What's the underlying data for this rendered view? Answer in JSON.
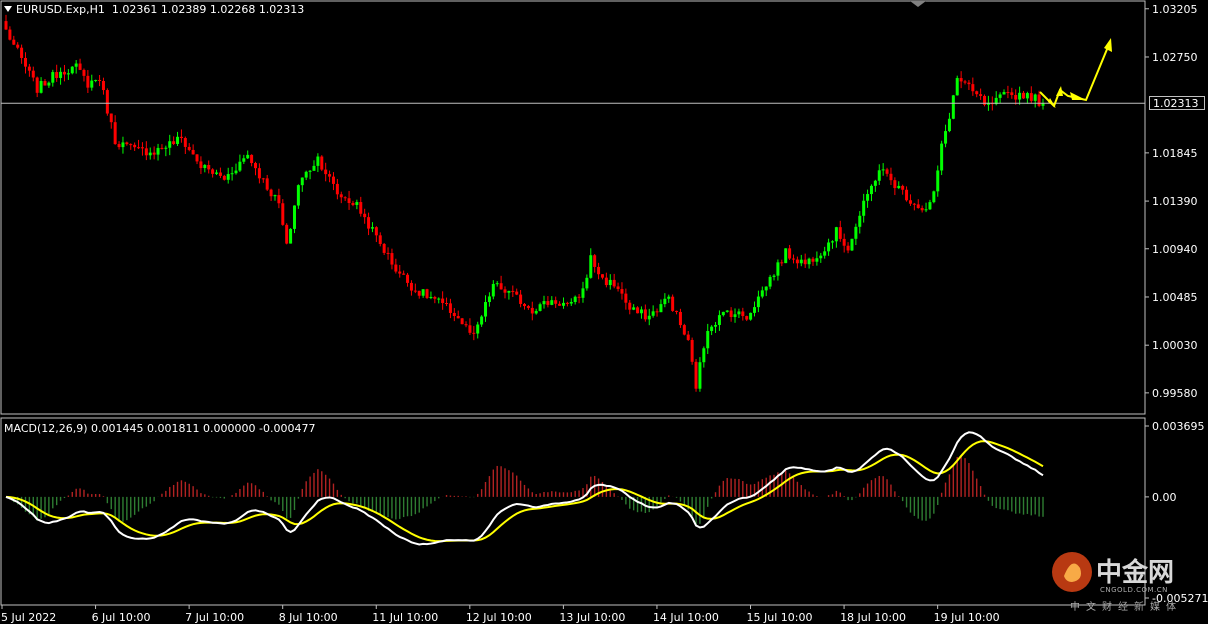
{
  "header": {
    "symbol": "EURUSD.Exp,H1",
    "ohlc": "1.02361 1.02389 1.02268 1.02313"
  },
  "macd_label": "MACD(12,26,9) 0.001445 0.001811 0.000000 -0.000477",
  "current_price_tag": "1.02313",
  "watermark": {
    "brand": "中金网",
    "domain": "CNGOLD.COM.CN",
    "tagline": "中文财经新媒体"
  },
  "colors": {
    "background": "#000000",
    "bull": "#00ff00",
    "bear": "#ff0000",
    "macd_line": "#ffffff",
    "signal_line": "#ffff00",
    "hist_pos": "#b22222",
    "hist_neg": "#2e7d32",
    "arrow": "#ffff00"
  },
  "chart_data": [
    {
      "type": "candlestick",
      "price_axis": {
        "min": 0.9939,
        "max": 1.0325,
        "ticks": [
          "1.03205",
          "1.02750",
          "1.02313",
          "1.01845",
          "1.01390",
          "1.00940",
          "1.00485",
          "1.00030",
          "0.99580"
        ]
      },
      "current_price": 1.02313,
      "x_ticks": [
        "5 Jul 2022",
        "6 Jul 10:00",
        "7 Jul 10:00",
        "8 Jul 10:00",
        "11 Jul 10:00",
        "12 Jul 10:00",
        "13 Jul 10:00",
        "14 Jul 10:00",
        "15 Jul 10:00",
        "18 Jul 10:00",
        "19 Jul 10:00"
      ],
      "close_path": [
        [
          0,
          1.03
        ],
        [
          8,
          1.0245
        ],
        [
          14,
          1.0262
        ],
        [
          18,
          1.0265
        ],
        [
          21,
          1.025
        ],
        [
          24,
          1.0255
        ],
        [
          28,
          1.0196
        ],
        [
          33,
          1.0187
        ],
        [
          38,
          1.0186
        ],
        [
          45,
          1.0198
        ],
        [
          50,
          1.0172
        ],
        [
          56,
          1.016
        ],
        [
          62,
          1.0183
        ],
        [
          66,
          1.0158
        ],
        [
          70,
          1.0136
        ],
        [
          72,
          1.0095
        ],
        [
          75,
          1.0155
        ],
        [
          80,
          1.018
        ],
        [
          85,
          1.0146
        ],
        [
          90,
          1.0135
        ],
        [
          95,
          1.0105
        ],
        [
          100,
          1.0075
        ],
        [
          105,
          1.0055
        ],
        [
          110,
          1.0046
        ],
        [
          115,
          1.0033
        ],
        [
          120,
          1.001
        ],
        [
          125,
          1.006
        ],
        [
          130,
          1.005
        ],
        [
          135,
          1.0037
        ],
        [
          140,
          1.0045
        ],
        [
          145,
          1.004
        ],
        [
          148,
          1.0055
        ],
        [
          150,
          1.0085
        ],
        [
          153,
          1.0065
        ],
        [
          157,
          1.0058
        ],
        [
          160,
          1.0036
        ],
        [
          165,
          1.003
        ],
        [
          170,
          1.0048
        ],
        [
          175,
          1.0005
        ],
        [
          177,
          0.9965
        ],
        [
          180,
          1.002
        ],
        [
          185,
          1.0035
        ],
        [
          190,
          1.003
        ],
        [
          195,
          1.006
        ],
        [
          200,
          1.009
        ],
        [
          205,
          1.008
        ],
        [
          210,
          1.0095
        ],
        [
          213,
          1.011
        ],
        [
          216,
          1.0095
        ],
        [
          220,
          1.0135
        ],
        [
          224,
          1.017
        ],
        [
          228,
          1.0155
        ],
        [
          232,
          1.014
        ],
        [
          236,
          1.013
        ],
        [
          238,
          1.0145
        ],
        [
          240,
          1.019
        ],
        [
          242,
          1.022
        ],
        [
          244,
          1.0255
        ],
        [
          247,
          1.0245
        ],
        [
          252,
          1.0228
        ],
        [
          256,
          1.0238
        ],
        [
          262,
          1.024
        ],
        [
          266,
          1.0231
        ]
      ]
    },
    {
      "type": "macd",
      "params": [
        12,
        26,
        9
      ],
      "values": {
        "macd": 0.001445,
        "signal": 0.001811,
        "extra": 0.0,
        "histogram": -0.000477
      },
      "y_axis": {
        "min": -0.005271,
        "max": 0.003695,
        "ticks": [
          "0.003695",
          "0.00",
          "-0.005271"
        ]
      }
    }
  ]
}
